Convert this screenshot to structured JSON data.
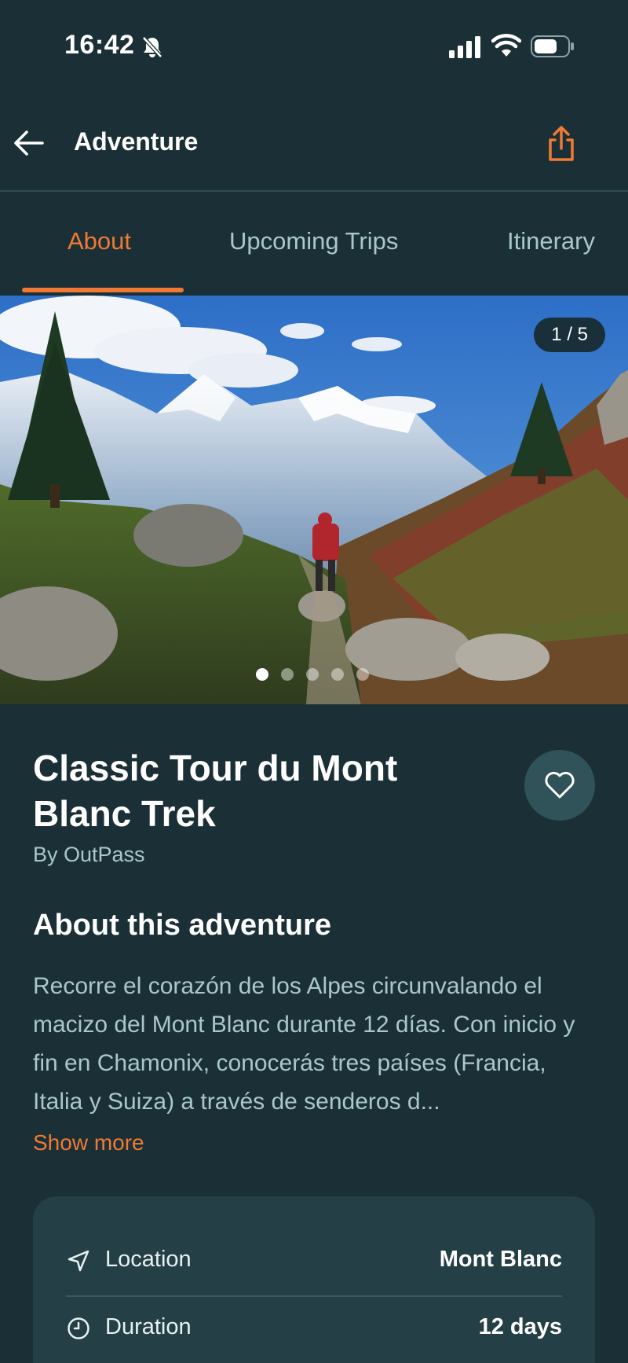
{
  "status_bar": {
    "time": "16:42"
  },
  "header": {
    "title": "Adventure"
  },
  "tabs": [
    {
      "label": "About",
      "active": true
    },
    {
      "label": "Upcoming Trips",
      "active": false
    },
    {
      "label": "Itinerary",
      "active": false
    }
  ],
  "hero": {
    "counter": "1 / 5",
    "dot_count": 5,
    "active_dot": 1
  },
  "trip": {
    "title": "Classic Tour du Mont Blanc Trek",
    "byline": "By OutPass"
  },
  "about": {
    "heading": "About this adventure",
    "description": "Recorre el corazón de los Alpes circunvalando el macizo del Mont Blanc durante 12 días. Con inicio y fin en Chamonix, conocerás tres países (Francia, Italia y Suiza) a través de senderos d...",
    "show_more": "Show more"
  },
  "details": [
    {
      "icon": "location-arrow-icon",
      "label": "Location",
      "value": "Mont Blanc"
    },
    {
      "icon": "clock-icon",
      "label": "Duration",
      "value": "12 days"
    }
  ],
  "colors": {
    "background": "#1b2f36",
    "accent": "#f07a33",
    "muted_text": "#a9c8cc",
    "card": "#243f46"
  }
}
